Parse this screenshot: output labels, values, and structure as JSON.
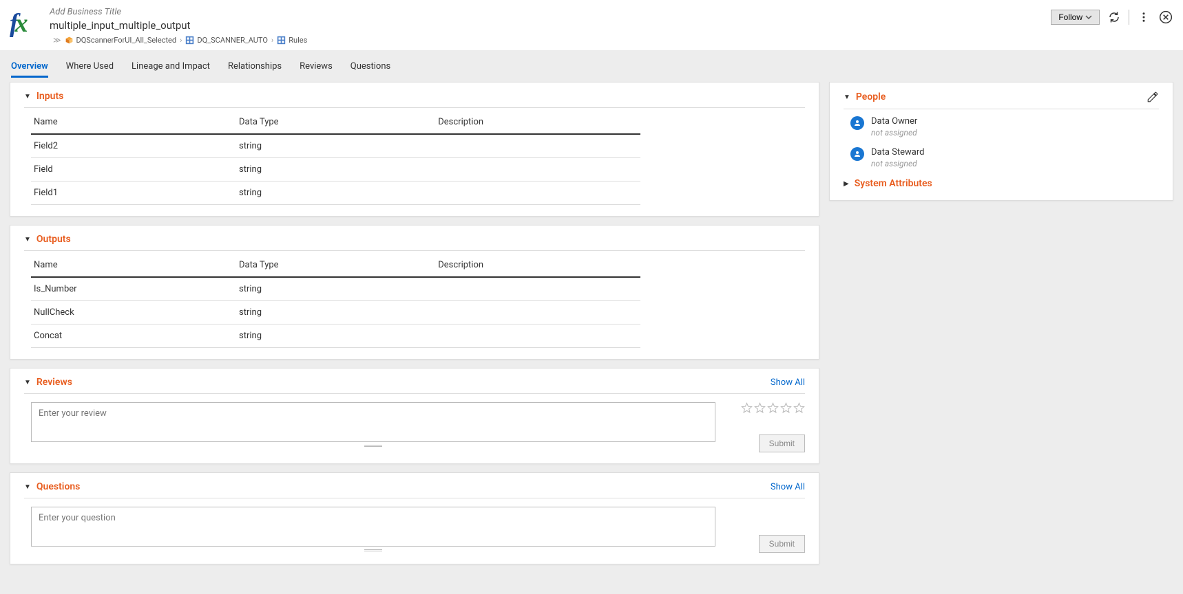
{
  "header": {
    "business_title_placeholder": "Add Business Title",
    "asset_name": "multiple_input_multiple_output",
    "follow_label": "Follow",
    "breadcrumb": [
      {
        "label": "DQScannerForUI_All_Selected",
        "icon": "cube"
      },
      {
        "label": "DQ_SCANNER_AUTO",
        "icon": "grid"
      },
      {
        "label": "Rules",
        "icon": "grid"
      }
    ]
  },
  "tabs": [
    {
      "label": "Overview",
      "active": true
    },
    {
      "label": "Where Used"
    },
    {
      "label": "Lineage and Impact"
    },
    {
      "label": "Relationships"
    },
    {
      "label": "Reviews"
    },
    {
      "label": "Questions"
    }
  ],
  "sections": {
    "inputs": {
      "title": "Inputs",
      "columns": [
        "Name",
        "Data Type",
        "Description"
      ],
      "rows": [
        {
          "name": "Field2",
          "type": "string",
          "desc": ""
        },
        {
          "name": "Field",
          "type": "string",
          "desc": ""
        },
        {
          "name": "Field1",
          "type": "string",
          "desc": ""
        }
      ]
    },
    "outputs": {
      "title": "Outputs",
      "columns": [
        "Name",
        "Data Type",
        "Description"
      ],
      "rows": [
        {
          "name": "Is_Number",
          "type": "string",
          "desc": ""
        },
        {
          "name": "NullCheck",
          "type": "string",
          "desc": ""
        },
        {
          "name": "Concat",
          "type": "string",
          "desc": ""
        }
      ]
    },
    "reviews": {
      "title": "Reviews",
      "show_all": "Show All",
      "placeholder": "Enter your review",
      "submit": "Submit"
    },
    "questions": {
      "title": "Questions",
      "show_all": "Show All",
      "placeholder": "Enter your question",
      "submit": "Submit"
    },
    "people": {
      "title": "People",
      "items": [
        {
          "role": "Data Owner",
          "assigned": "not assigned"
        },
        {
          "role": "Data Steward",
          "assigned": "not assigned"
        }
      ]
    },
    "system_attributes": {
      "title": "System Attributes"
    }
  }
}
